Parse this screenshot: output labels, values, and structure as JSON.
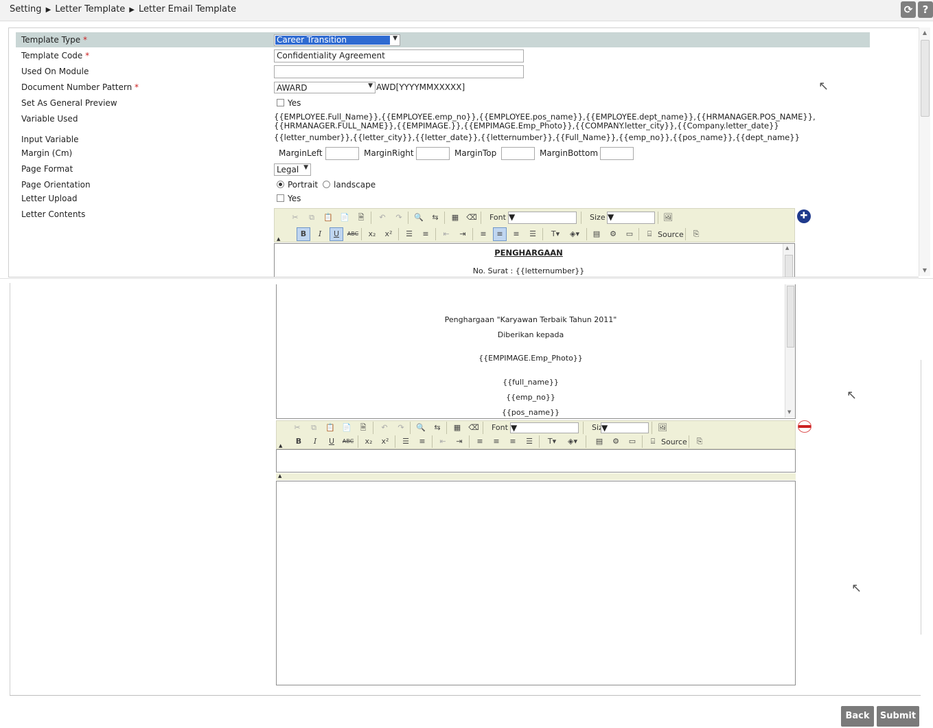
{
  "breadcrumb": {
    "items": [
      "Setting",
      "Letter Template",
      "Letter Email Template"
    ],
    "sep": "▶"
  },
  "topbar": {
    "refresh": "⟳",
    "help": "?"
  },
  "form": {
    "template_type": {
      "label": "Template Type",
      "required": "*",
      "value": "Career Transition"
    },
    "template_code": {
      "label": "Template Code",
      "required": "*",
      "value": "Confidentiality Agreement"
    },
    "used_on_module": {
      "label": "Used On Module",
      "value": ""
    },
    "doc_number_pattern": {
      "label": "Document Number Pattern",
      "required": "*",
      "value": "AWARD",
      "suffix": "AWD[YYYYMMXXXXX]"
    },
    "general_preview": {
      "label": "Set As General Preview",
      "option": "Yes"
    },
    "variable_used": {
      "label": "Variable Used",
      "line1": "{{EMPLOYEE.Full_Name}},{{EMPLOYEE.emp_no}},{{EMPLOYEE.pos_name}},{{EMPLOYEE.dept_name}},{{HRMANAGER.POS_NAME}},",
      "line2": "{{HRMANAGER.FULL_NAME}},{{EMPIMAGE.}},{{EMPIMAGE.Emp_Photo}},{{COMPANY.letter_city}},{{Company.letter_date}}"
    },
    "input_variable": {
      "label": "Input Variable",
      "value": "{{letter_number}},{{letter_city}},{{letter_date}},{{letternumber}},{{Full_Name}},{{emp_no}},{{pos_name}},{{dept_name}}"
    },
    "margin": {
      "label": "Margin (Cm)",
      "left": "MarginLeft",
      "right": "MarginRight",
      "top": "MarginTop",
      "bottom": "MarginBottom"
    },
    "page_format": {
      "label": "Page Format",
      "value": "Legal"
    },
    "page_orientation": {
      "label": "Page Orientation",
      "portrait": "Portrait",
      "landscape": "landscape"
    },
    "letter_upload": {
      "label": "Letter Upload",
      "option": "Yes"
    },
    "letter_contents": {
      "label": "Letter Contents"
    }
  },
  "editor": {
    "font_label": "Font",
    "size_label": "Size",
    "source_label": "Source"
  },
  "letter": {
    "heading": "PENGHARGAAN",
    "no_surat": "No. Surat : {{letternumber}}",
    "award_line": "Penghargaan \"Karyawan Terbaik Tahun 2011\"",
    "given_to": "Diberikan kepada",
    "photo": "{{EMPIMAGE.Emp_Photo}}",
    "full_name": "{{full_name}}",
    "emp_no": "{{emp_no}}",
    "pos_name": "{{pos_name}}"
  },
  "buttons": {
    "back": "Back",
    "submit": "Submit"
  },
  "colors": {
    "header_row": "#c9d6d5",
    "toolbar": "#eff0d8",
    "button": "#7b7b7b",
    "selected_option": "#2f6bd1"
  }
}
